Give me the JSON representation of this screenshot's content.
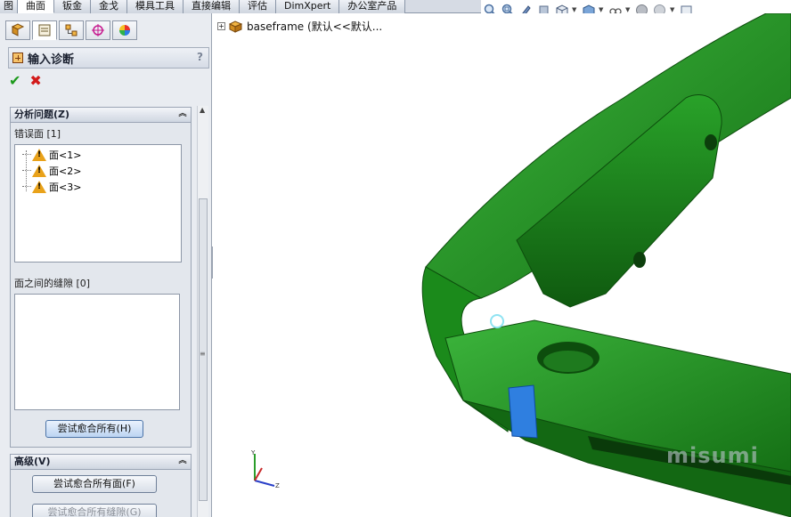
{
  "command_tabs": [
    "图",
    "曲面",
    "钣金",
    "金戈",
    "模具工具",
    "直接编辑",
    "评估",
    "DimXpert",
    "办公室产品"
  ],
  "active_tab_index": 1,
  "hud_icons": [
    "zoom-to-fit-icon",
    "zoom-area-icon",
    "previous-view-icon",
    "section-view-icon",
    "view-orientation-icon",
    "display-style-icon",
    "hide-show-icon",
    "edit-appearance-icon",
    "apply-scene-icon",
    "view-settings-icon"
  ],
  "property_manager": {
    "tab_icons": [
      "feature-manager-icon",
      "property-manager-icon",
      "configuration-manager-icon",
      "dimxpert-icon",
      "display-manager-icon"
    ],
    "title": "输入诊断",
    "help": "?",
    "analyze_group": {
      "title": "分析问题(Z)",
      "faulty_faces_label": "错误面 [1]",
      "faces": [
        "面<1>",
        "面<2>",
        "面<3>"
      ],
      "gaps_label": "面之间的缝隙 [0]",
      "heal_all_button": "尝试愈合所有(H)"
    },
    "advanced_group": {
      "title": "高级(V)",
      "heal_faces_button": "尝试愈合所有面(F)",
      "heal_gaps_button": "尝试愈合所有缝隙(G)"
    }
  },
  "feature_tree": {
    "part_name": "baseframe  (默认<<默认..."
  },
  "watermark": "misumi",
  "colors": {
    "model_green": "#1f8a1f",
    "highlight_face": "#2f7fe0",
    "ok_check": "#1c9a1c",
    "cancel_x": "#d21a1a"
  }
}
